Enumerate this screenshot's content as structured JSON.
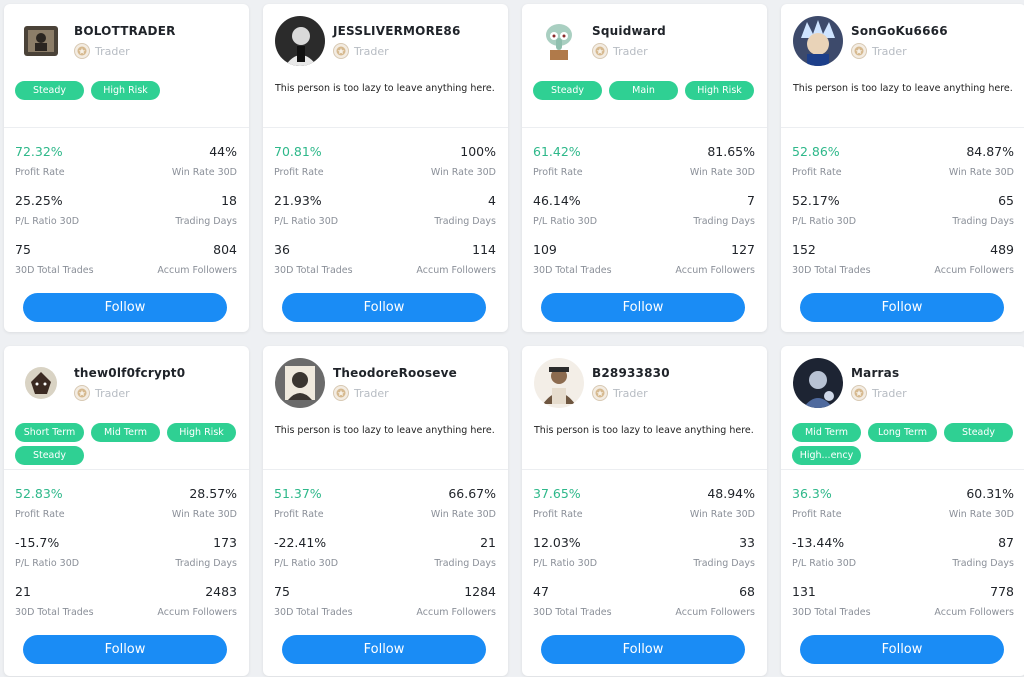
{
  "accent": "#1a8cf5",
  "tag_color": "#2fd093",
  "profit_color": "#2eb88a",
  "labels": {
    "profit_rate": "Profit Rate",
    "win_rate": "Win Rate 30D",
    "pl_ratio": "P/L Ratio 30D",
    "trading_days": "Trading Days",
    "total_trades": "30D Total Trades",
    "followers": "Accum Followers",
    "follow": "Follow"
  },
  "traders": [
    {
      "name": "BOLOTTRADER",
      "role": "Trader",
      "tags": [
        "Steady",
        "High Risk"
      ],
      "bio": "",
      "profit_rate": "72.32%",
      "win_rate": "44%",
      "pl_ratio": "25.25%",
      "trading_days": "18",
      "total_trades": "75",
      "followers": "804"
    },
    {
      "name": "JESSLIVERMORE86",
      "role": "Trader",
      "tags": [],
      "bio": "This person is too lazy to leave anything here.",
      "profit_rate": "70.81%",
      "win_rate": "100%",
      "pl_ratio": "21.93%",
      "trading_days": "4",
      "total_trades": "36",
      "followers": "114"
    },
    {
      "name": "Squidward",
      "role": "Trader",
      "tags": [
        "Steady",
        "Main",
        "High Risk"
      ],
      "bio": "",
      "profit_rate": "61.42%",
      "win_rate": "81.65%",
      "pl_ratio": "46.14%",
      "trading_days": "7",
      "total_trades": "109",
      "followers": "127"
    },
    {
      "name": "SonGoKu6666",
      "role": "Trader",
      "tags": [],
      "bio": "This person is too lazy to leave anything here.",
      "profit_rate": "52.86%",
      "win_rate": "84.87%",
      "pl_ratio": "52.17%",
      "trading_days": "65",
      "total_trades": "152",
      "followers": "489"
    },
    {
      "name": "thew0lf0fcrypt0",
      "role": "Trader",
      "tags": [
        "Short Term",
        "Mid Term",
        "High Risk",
        "Steady"
      ],
      "bio": "",
      "profit_rate": "52.83%",
      "win_rate": "28.57%",
      "pl_ratio": "-15.7%",
      "trading_days": "173",
      "total_trades": "21",
      "followers": "2483"
    },
    {
      "name": "TheodoreRooseve",
      "role": "Trader",
      "tags": [],
      "bio": "This person is too lazy to leave anything here.",
      "profit_rate": "51.37%",
      "win_rate": "66.67%",
      "pl_ratio": "-22.41%",
      "trading_days": "21",
      "total_trades": "75",
      "followers": "1284"
    },
    {
      "name": "B28933830",
      "role": "Trader",
      "tags": [],
      "bio": "This person is too lazy to leave anything here.",
      "profit_rate": "37.65%",
      "win_rate": "48.94%",
      "pl_ratio": "12.03%",
      "trading_days": "33",
      "total_trades": "47",
      "followers": "68"
    },
    {
      "name": "Marras",
      "role": "Trader",
      "tags": [
        "Mid Term",
        "Long Term",
        "Steady",
        "High...ency"
      ],
      "bio": "",
      "profit_rate": "36.3%",
      "win_rate": "60.31%",
      "pl_ratio": "-13.44%",
      "trading_days": "87",
      "total_trades": "131",
      "followers": "778"
    }
  ]
}
